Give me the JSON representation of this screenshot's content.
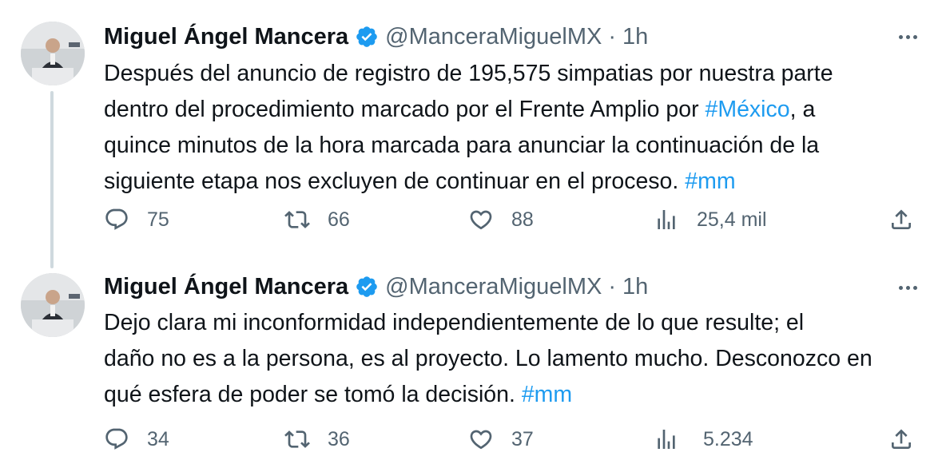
{
  "thread": [
    {
      "author": {
        "name": "Miguel Ángel Mancera",
        "handle": "@ManceraMiguelMX",
        "separator": "·",
        "time": "1h"
      },
      "lines": [
        {
          "text": "Después del anuncio de registro de 195,575 simpatias por nuestra parte",
          "tag": ""
        },
        {
          "text": "dentro del procedimiento marcado por el Frente Amplio por ",
          "tag": "#México",
          "after": ", a"
        },
        {
          "text": "quince minutos de la hora marcada para anunciar la continuación de la",
          "tag": ""
        },
        {
          "text": "siguiente etapa nos excluyen de continuar en el proceso. ",
          "tag": "#mm"
        }
      ],
      "stats": {
        "replies": "75",
        "retweets": "66",
        "likes": "88",
        "views": "25,4 mil"
      }
    },
    {
      "author": {
        "name": "Miguel Ángel Mancera",
        "handle": "@ManceraMiguelMX",
        "separator": "·",
        "time": "1h"
      },
      "lines": [
        {
          "text": "Dejo clara mi inconformidad independientemente de lo que resulte; el",
          "tag": ""
        },
        {
          "text": "daño no es a la persona, es al proyecto. Lo lamento mucho. Desconozco en",
          "tag": ""
        },
        {
          "text": "qué esfera de poder se tomó la decisión. ",
          "tag": "#mm"
        }
      ],
      "stats": {
        "replies": "34",
        "retweets": "36",
        "likes": "37",
        "views": "5.234"
      }
    }
  ],
  "icons": {
    "reply": "reply-icon",
    "retweet": "retweet-icon",
    "like": "heart-icon",
    "views": "views-chart-icon",
    "share": "share-icon",
    "more": "more-dots-icon",
    "verified": "verified-badge-icon"
  },
  "colors": {
    "text": "#0f1419",
    "secondary": "#536471",
    "link": "#1d9bf0",
    "verified": "#1d9bf0",
    "thread_line": "#cfd9de"
  }
}
